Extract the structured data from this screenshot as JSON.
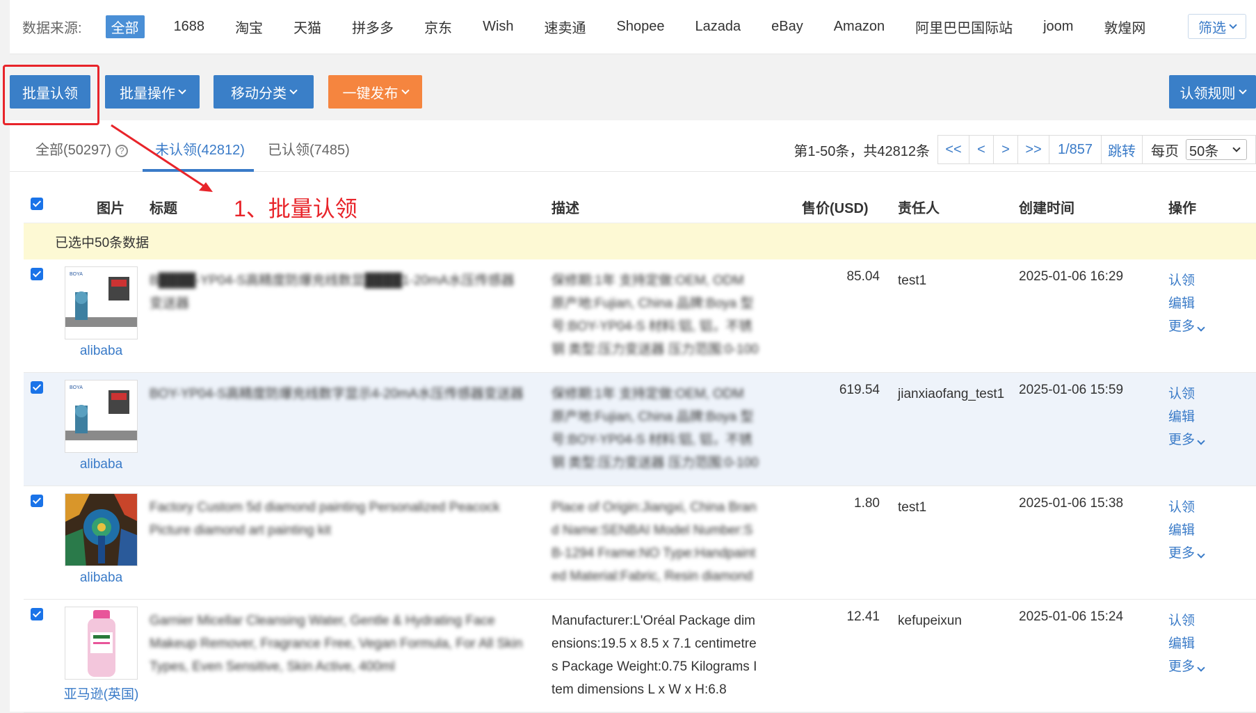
{
  "source_bar": {
    "label": "数据来源:",
    "sources": [
      "全部",
      "1688",
      "淘宝",
      "天猫",
      "拼多多",
      "京东",
      "Wish",
      "速卖通",
      "Shopee",
      "Lazada",
      "eBay",
      "Amazon",
      "阿里巴巴国际站",
      "joom",
      "敦煌网"
    ],
    "active": "全部",
    "filter_label": "筛选"
  },
  "toolbar": {
    "batch_claim": "批量认领",
    "batch_ops": "批量操作",
    "move_category": "移动分类",
    "one_click_publish": "一键发布",
    "claim_rules": "认领规则"
  },
  "tabs": {
    "all": "全部(50297)",
    "unclaimed": "未认领(42812)",
    "claimed": "已认领(7485)"
  },
  "pager": {
    "info": "第1-50条，共42812条",
    "first": "<<",
    "prev": "<",
    "next": ">",
    "last": ">>",
    "page": "1/857",
    "jump": "跳转",
    "per_page_label": "每页",
    "per_page_value": "50条"
  },
  "annotation": "1、批量认领",
  "table": {
    "headers": {
      "image": "图片",
      "title": "标题",
      "desc": "描述",
      "price": "售价(USD)",
      "owner": "责任人",
      "created": "创建时间",
      "ops": "操作"
    },
    "selected_info": "已选中50条数据",
    "rows": [
      {
        "source": "alibaba",
        "title": "B████-YP04-S高精度防爆充线数显████1-20mA水压传感器变送器",
        "desc": "保修期:1年 支持定做:OEM, ODM 原产地:Fujian, China 品牌:Boya 型号:BOY-YP04-S 材料:铝, 铝，不锈钢 类型:压力变送器 压力范围:0-100",
        "price": "85.04",
        "owner": "test1",
        "created": "2025-01-06 16:29"
      },
      {
        "source": "alibaba",
        "title": "BOY-YP04-S高精度防爆充线数字显示4-20mA水压传感器变送器",
        "desc": "保修期:1年 支持定做:OEM, ODM 原产地:Fujian, China 品牌:Boya 型号:BOY-YP04-S 材料:铝, 铝，不锈钢 类型:压力变送器 压力范围:0-100",
        "price": "619.54",
        "owner": "jianxiaofang_test1",
        "created": "2025-01-06 15:59"
      },
      {
        "source": "alibaba",
        "title": "Factory Custom 5d diamond painting Personalized Peacock Picture diamond art painting kit",
        "desc": "Place of Origin:Jiangxi, China Brand Name:SENBAI Model Number:SB-1294 Frame:NO Type:Handpainted Material:Fabric, Resin diamond",
        "price": "1.80",
        "owner": "test1",
        "created": "2025-01-06 15:38"
      },
      {
        "source": "亚马逊(英国)",
        "title": "Garnier Micellar Cleansing Water, Gentle & Hydrating Face Makeup Remover, Fragrance Free, Vegan Formula, For All Skin Types, Even Sensitive, Skin Active, 400ml",
        "desc": "Manufacturer:L'Oréal Package dimensions:19.5 x 8.5 x 7.1 centimetres Package Weight:0.75 Kilograms Item dimensions L x W x H:6.8",
        "price": "12.41",
        "owner": "kefupeixun",
        "created": "2025-01-06 15:24"
      }
    ],
    "row_ops": [
      "认领",
      "编辑",
      "更多"
    ]
  },
  "colors": {
    "primary": "#3a7fc8",
    "orange": "#f5853f",
    "highlight": "#e8242a",
    "selected_bar": "#fdf9d4"
  }
}
